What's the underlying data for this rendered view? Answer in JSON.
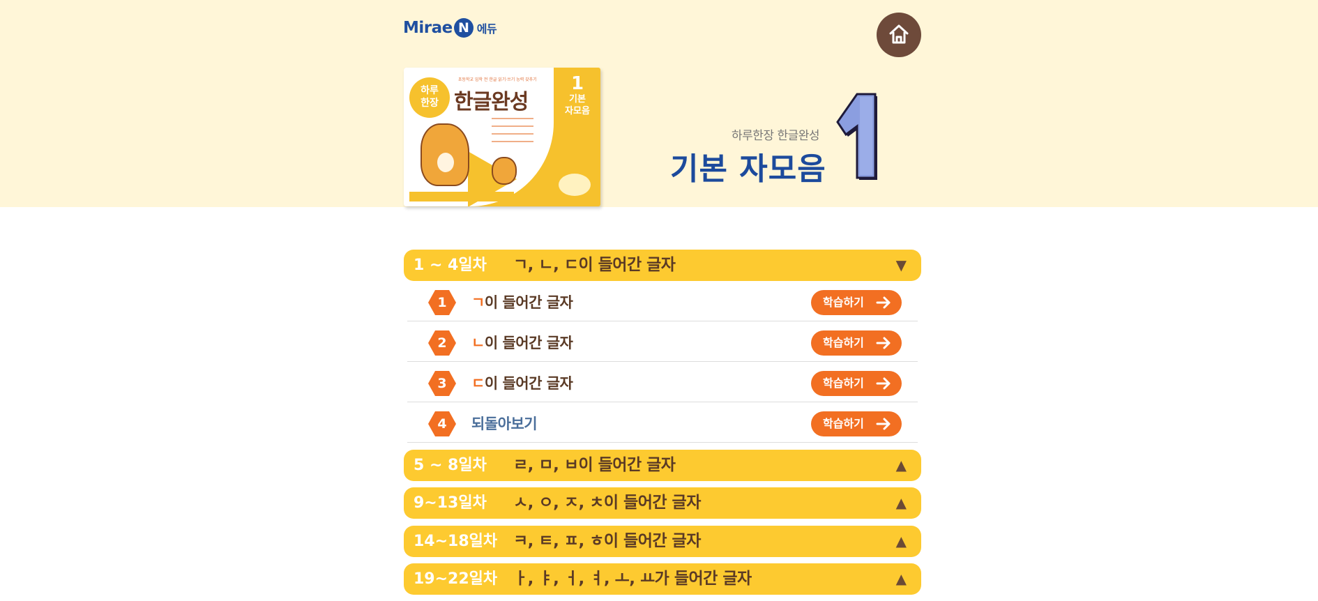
{
  "header": {
    "logo_text": "Mirae",
    "logo_n": "N",
    "logo_suffix": "에듀",
    "home_icon": "home-icon"
  },
  "book": {
    "badge_line1": "하루",
    "badge_line2": "한장",
    "title": "한글완성",
    "tagline": "초등학교 입학 전 한글 읽기·쓰기 능력 갖추기",
    "volume_number": "1",
    "volume_line1": "기본",
    "volume_line2": "자모음"
  },
  "title": {
    "series": "하루한장 한글완성",
    "main": "기본 자모음"
  },
  "sections": [
    {
      "days": "1 ~  4일차",
      "label": "ㄱ, ㄴ, ㄷ이 들어간 글자",
      "toggle": "▼",
      "expanded": true
    },
    {
      "days": "5 ~  8일차",
      "label": "ㄹ, ㅁ, ㅂ이 들어간 글자",
      "toggle": "▲",
      "expanded": false
    },
    {
      "days": "9~13일차",
      "label": "ㅅ, ㅇ, ㅈ, ㅊ이 들어간 글자",
      "toggle": "▲",
      "expanded": false
    },
    {
      "days": "14~18일차",
      "label": "ㅋ, ㅌ, ㅍ, ㅎ이 들어간 글자",
      "toggle": "▲",
      "expanded": false
    },
    {
      "days": "19~22일차",
      "label": "ㅏ, ㅑ, ㅓ, ㅕ, ㅗ, ㅛ가 들어간 글자",
      "toggle": "▲",
      "expanded": false
    }
  ],
  "lessons": [
    {
      "num": "1",
      "consonant": "ㄱ",
      "rest": "이 들어간 글자",
      "button": "학습하기"
    },
    {
      "num": "2",
      "consonant": "ㄴ",
      "rest": "이 들어간 글자",
      "button": "학습하기"
    },
    {
      "num": "3",
      "consonant": "ㄷ",
      "rest": "이 들어간 글자",
      "button": "학습하기"
    },
    {
      "num": "4",
      "consonant": "",
      "rest": "되돌아보기",
      "button": "학습하기"
    }
  ],
  "colors": {
    "accent_orange": "#f26f22",
    "bar_yellow": "#fdca30",
    "title_blue": "#1c4a9c",
    "hero_bg": "#fff6d8"
  }
}
